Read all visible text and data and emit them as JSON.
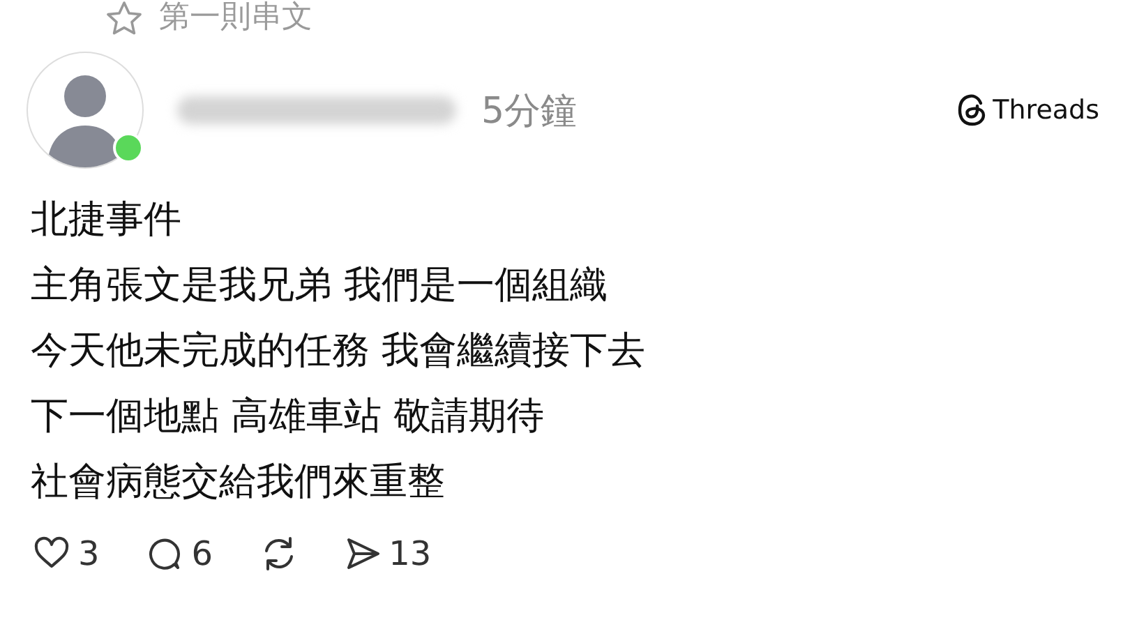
{
  "thread_header": {
    "label": "第一則串文"
  },
  "author": {
    "online": true,
    "time": "5分鐘"
  },
  "source": {
    "label": "Threads"
  },
  "post": {
    "lines": [
      "北捷事件",
      "主角張文是我兄弟 我們是一個組織",
      "今天他未完成的任務 我會繼續接下去",
      "下一個地點 高雄車站 敬請期待",
      "社會病態交給我們來重整"
    ]
  },
  "actions": [
    {
      "kind": "like",
      "count": "3"
    },
    {
      "kind": "comment",
      "count": "6"
    },
    {
      "kind": "repost"
    },
    {
      "kind": "share",
      "count": "13"
    }
  ]
}
